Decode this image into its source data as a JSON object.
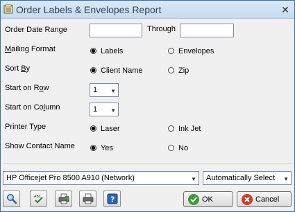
{
  "window": {
    "title": "Order Labels & Envelopes Report",
    "close": "✕"
  },
  "fields": {
    "order_date_range": {
      "label": "Order Date Range",
      "from_value": "",
      "through_label": "Through",
      "to_value": ""
    },
    "mailing_format": {
      "label_pre": "",
      "label_ul": "M",
      "label_post": "ailing Format",
      "options": [
        "Labels",
        "Envelopes"
      ],
      "selected": "Labels"
    },
    "sort_by": {
      "label_pre": "Sort ",
      "label_ul": "B",
      "label_post": "y",
      "options": [
        "Client Name",
        "Zip"
      ],
      "selected": "Client Name"
    },
    "start_on_row": {
      "label_pre": "Start on R",
      "label_ul": "o",
      "label_post": "w",
      "value": "1"
    },
    "start_on_column": {
      "label_pre": "Start on Co",
      "label_ul": "l",
      "label_post": "umn",
      "value": "1"
    },
    "printer_type": {
      "label": "Printer Type",
      "options": [
        "Laser",
        "Ink Jet"
      ],
      "selected": "Laser"
    },
    "show_contact_name": {
      "label": "Show Contact Name",
      "options": [
        "Yes",
        "No"
      ],
      "selected": "Yes"
    }
  },
  "printer": {
    "name": "HP Officejet Pro 8500 A910 (Network)",
    "tray": "Automatically Select"
  },
  "toolbar": {
    "icons": [
      "preview-icon",
      "spellcheck-icon",
      "print-setup-icon",
      "print-icon",
      "help-icon"
    ]
  },
  "buttons": {
    "ok": "OK",
    "cancel": "Cancel"
  },
  "colors": {
    "ok_icon": "#3f9a3a",
    "cancel_icon": "#d23b2b",
    "titlebar": "#c5daf1"
  }
}
